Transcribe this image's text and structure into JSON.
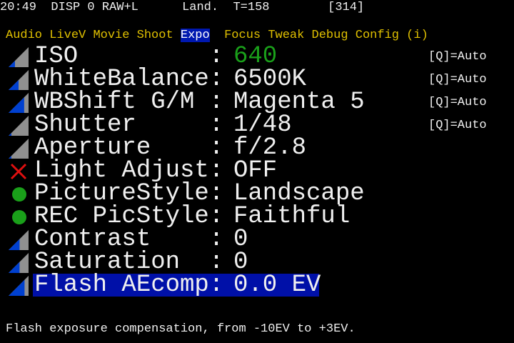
{
  "status": {
    "time": "20:49",
    "disp": "DISP 0 RAW+L",
    "picstyle": "Land.",
    "temp": "T=158",
    "shots": "[314]"
  },
  "tabs": [
    {
      "label": "Audio",
      "selected": false
    },
    {
      "label": "LiveV",
      "selected": false
    },
    {
      "label": "Movie",
      "selected": false
    },
    {
      "label": "Shoot",
      "selected": false
    },
    {
      "label": "Expo",
      "selected": true
    },
    {
      "label": "Focus",
      "selected": false
    },
    {
      "label": "Tweak",
      "selected": false
    },
    {
      "label": "Debug",
      "selected": false
    },
    {
      "label": "Config",
      "selected": false
    },
    {
      "label": "(i)",
      "selected": false
    }
  ],
  "items": [
    {
      "label": "ISO         :",
      "value": "640",
      "hint": "[Q]=Auto",
      "icon": "slider-triangle",
      "level": 0.32,
      "value_color": "#1aa01a"
    },
    {
      "label": "WhiteBalance:",
      "value": "6500K",
      "hint": "[Q]=Auto",
      "icon": "slider-triangle",
      "level": 0.5
    },
    {
      "label": "WBShift G/M :",
      "value": "Magenta 5",
      "hint": "[Q]=Auto",
      "icon": "slider-triangle",
      "level": 0.78
    },
    {
      "label": "Shutter     :",
      "value": "1/48",
      "hint": "[Q]=Auto",
      "icon": "slider-triangle",
      "level": 0.14
    },
    {
      "label": "Aperture    :",
      "value": "f/2.8",
      "hint": "",
      "icon": "slider-triangle",
      "level": 0.14
    },
    {
      "label": "Light Adjust:",
      "value": "OFF",
      "hint": "",
      "icon": "x-mark"
    },
    {
      "label": "PictureStyle:",
      "value": "Landscape",
      "hint": "",
      "icon": "green-dot"
    },
    {
      "label": "REC PicStyle:",
      "value": "Faithful",
      "hint": "",
      "icon": "green-dot"
    },
    {
      "label": "Contrast    :",
      "value": "0",
      "hint": "",
      "icon": "slider-triangle",
      "level": 0.55
    },
    {
      "label": "Saturation  :",
      "value": "0",
      "hint": "",
      "icon": "slider-triangle",
      "level": 0.55
    },
    {
      "label": "Flash AEcomp:",
      "value": "0.0 EV",
      "hint": "",
      "icon": "slider-triangle",
      "level": 0.8,
      "selected": true
    }
  ],
  "help": "Flash exposure compensation, from -10EV to +3EV.",
  "colors": {
    "tab": "#e0c000",
    "selection": "#0010a8",
    "blue": "#0040d0",
    "gray": "#909090",
    "green": "#1aa01a",
    "red": "#e01010"
  }
}
